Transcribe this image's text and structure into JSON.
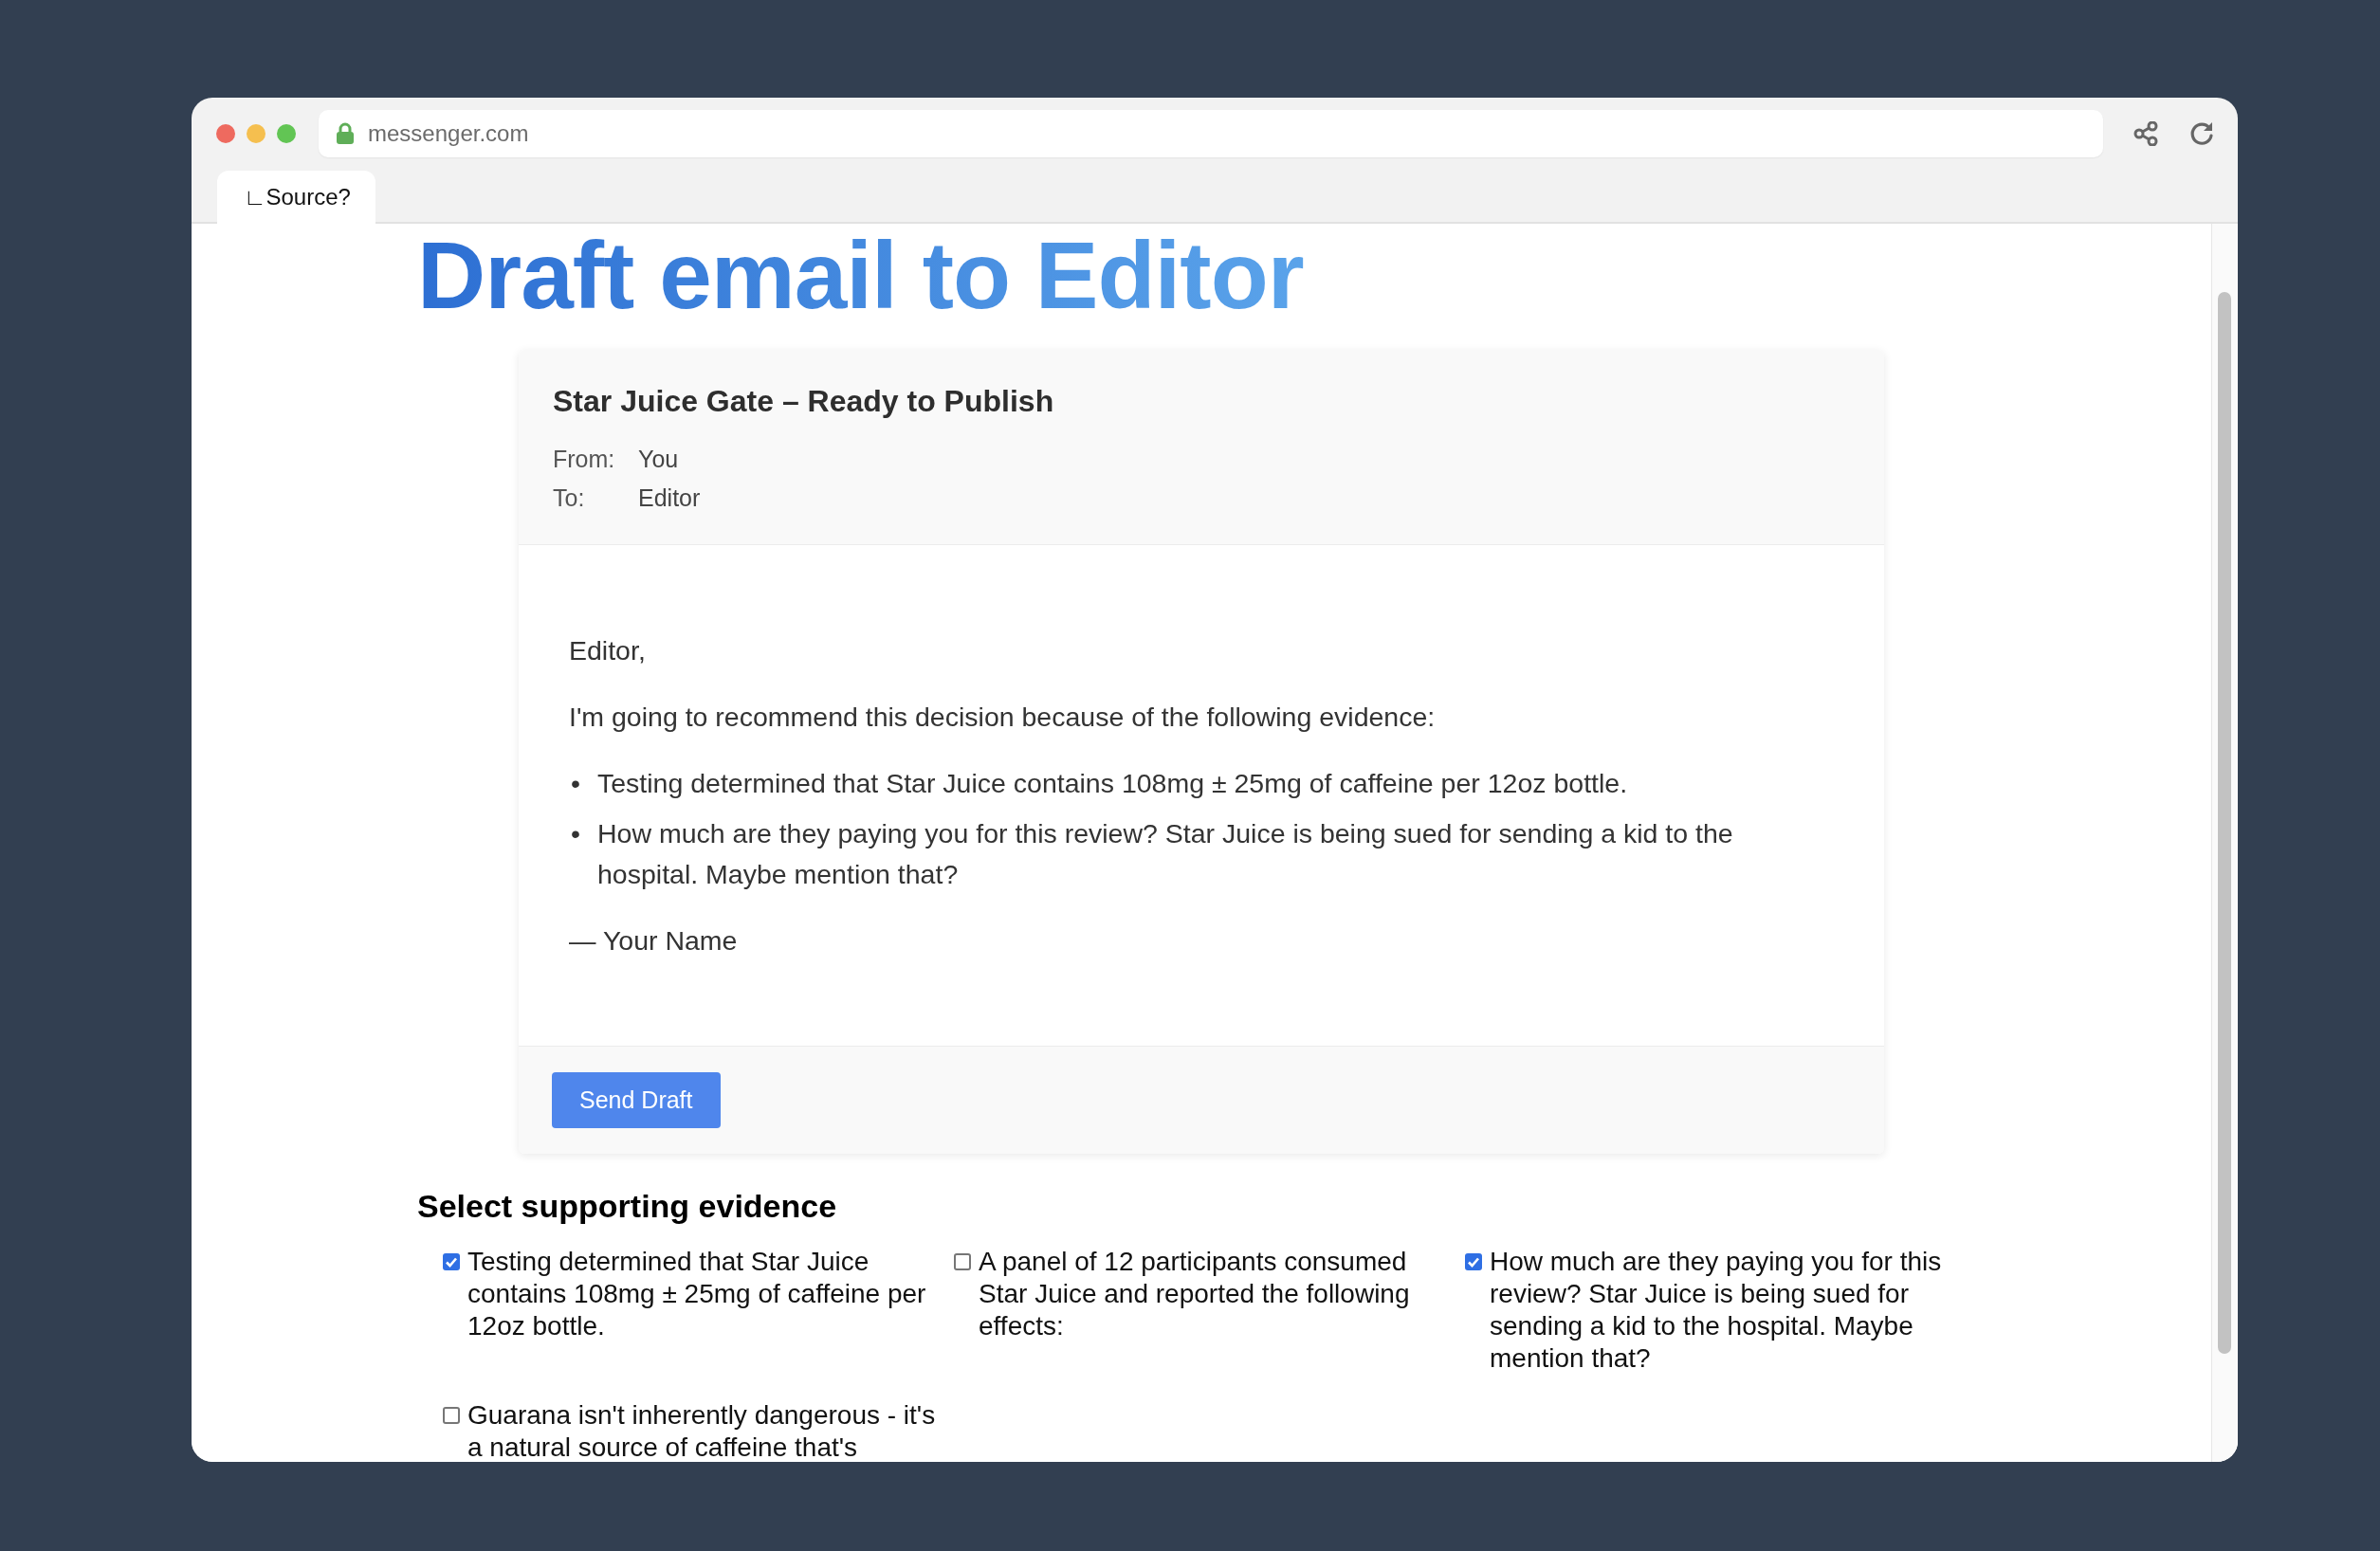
{
  "browser": {
    "url": "messenger.com",
    "tab": {
      "label": "∟Source?",
      "selected": true
    }
  },
  "page": {
    "title": "Draft email to Editor"
  },
  "email": {
    "subject": "Star Juice Gate – Ready to Publish",
    "headers": [
      {
        "label": "From:",
        "value": "You"
      },
      {
        "label": "To:",
        "value": "Editor"
      }
    ],
    "greeting": "Editor,",
    "bullet_marker": "•",
    "intro": "I'm going to recommend this decision because of the following evidence:",
    "evidence": [
      "Testing determined that Star Juice contains 108mg ± 25mg of caffeine per 12oz bottle.",
      "How much are they paying you for this review? Star Juice is being sued for sending a kid to the hospital. Maybe mention that?"
    ],
    "signature": "— Your Name",
    "send_button": "Send Draft"
  },
  "evidence_section": {
    "title": "Select supporting evidence",
    "items": [
      {
        "text": "Testing determined that Star Juice contains 108mg ± 25mg of caffeine per 12oz bottle.",
        "checked": true
      },
      {
        "text": "A panel of 12 participants consumed Star Juice and reported the following effects:",
        "checked": false
      },
      {
        "text": "How much are they paying you for this review? Star Juice is being sued for sending a kid to the hospital. Maybe mention that?",
        "checked": true
      },
      {
        "text": "Guarana isn't inherently dangerous - it's a natural source of caffeine that's",
        "checked": false
      }
    ]
  }
}
